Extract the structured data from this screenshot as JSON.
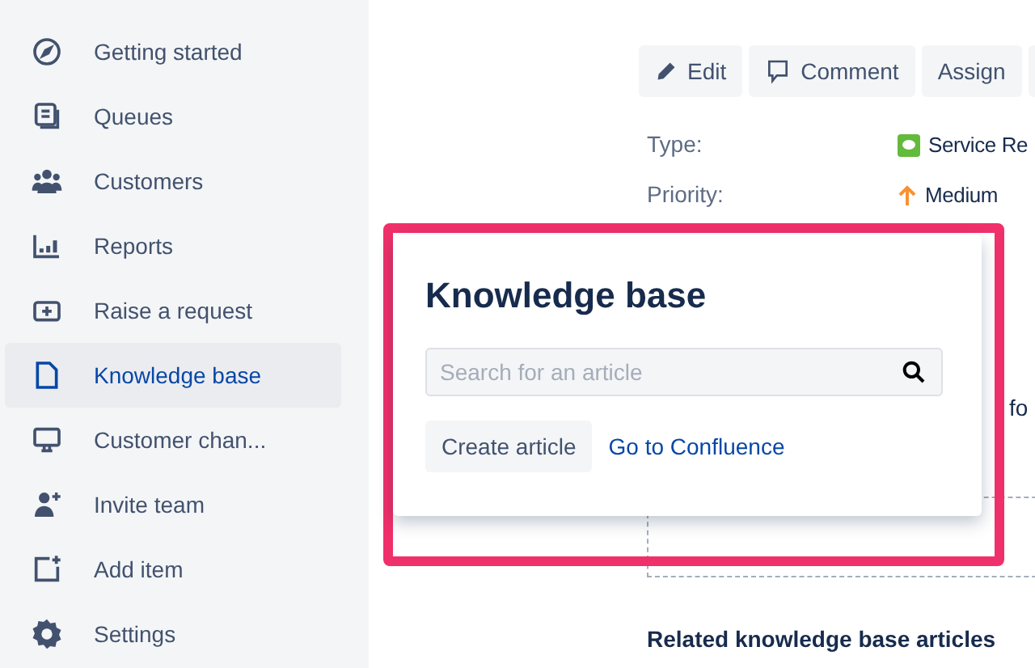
{
  "sidebar": {
    "items": [
      {
        "kind": "compass",
        "label": "Getting started",
        "selected": false
      },
      {
        "kind": "queues",
        "label": "Queues",
        "selected": false
      },
      {
        "kind": "people",
        "label": "Customers",
        "selected": false
      },
      {
        "kind": "chart",
        "label": "Reports",
        "selected": false
      },
      {
        "kind": "request",
        "label": "Raise a request",
        "selected": false
      },
      {
        "kind": "page",
        "label": "Knowledge base",
        "selected": true
      },
      {
        "kind": "monitor",
        "label": "Customer chan...",
        "selected": false
      },
      {
        "kind": "invite",
        "label": "Invite team",
        "selected": false
      },
      {
        "kind": "add",
        "label": "Add item",
        "selected": false
      },
      {
        "kind": "gear",
        "label": "Settings",
        "selected": false
      }
    ]
  },
  "toolbar": {
    "buttons": [
      {
        "kind": "pencil",
        "label": "Edit"
      },
      {
        "kind": "comment",
        "label": "Comment"
      },
      {
        "kind": "none",
        "label": "Assign"
      }
    ]
  },
  "fields": [
    {
      "kind": "type",
      "label": "Type:",
      "value": "Service Re"
    },
    {
      "kind": "priority",
      "label": "Priority:",
      "value": "Medium"
    }
  ],
  "partial_text": "fo",
  "related_heading": "Related knowledge base articles",
  "popup": {
    "title": "Knowledge base",
    "search": {
      "placeholder": "Search for an article"
    },
    "create_button": "Create article",
    "confluence_link": "Go to Confluence"
  }
}
